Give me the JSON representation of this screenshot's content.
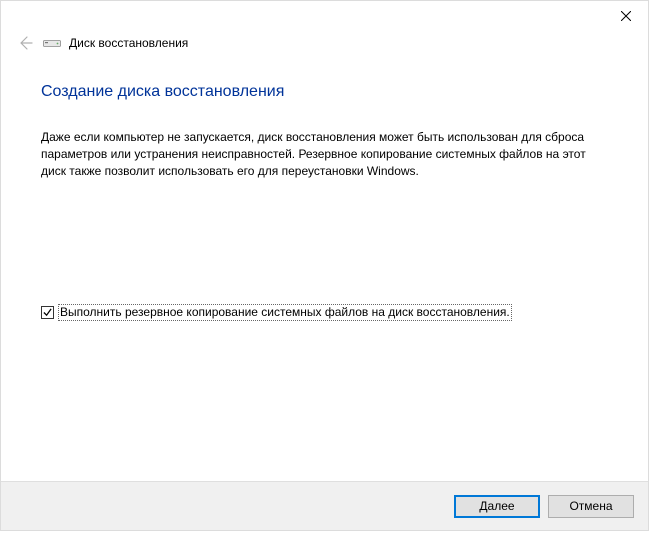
{
  "window": {
    "title": "Диск восстановления"
  },
  "page": {
    "heading": "Создание диска восстановления",
    "description": "Даже если компьютер не запускается, диск восстановления может быть использован для сброса параметров или устранения неисправностей. Резервное копирование системных файлов на этот диск также позволит использовать его для переустановки Windows."
  },
  "checkbox": {
    "label": "Выполнить резервное копирование системных файлов на диск восстановления.",
    "checked": true
  },
  "buttons": {
    "next": "Далее",
    "cancel": "Отмена"
  }
}
